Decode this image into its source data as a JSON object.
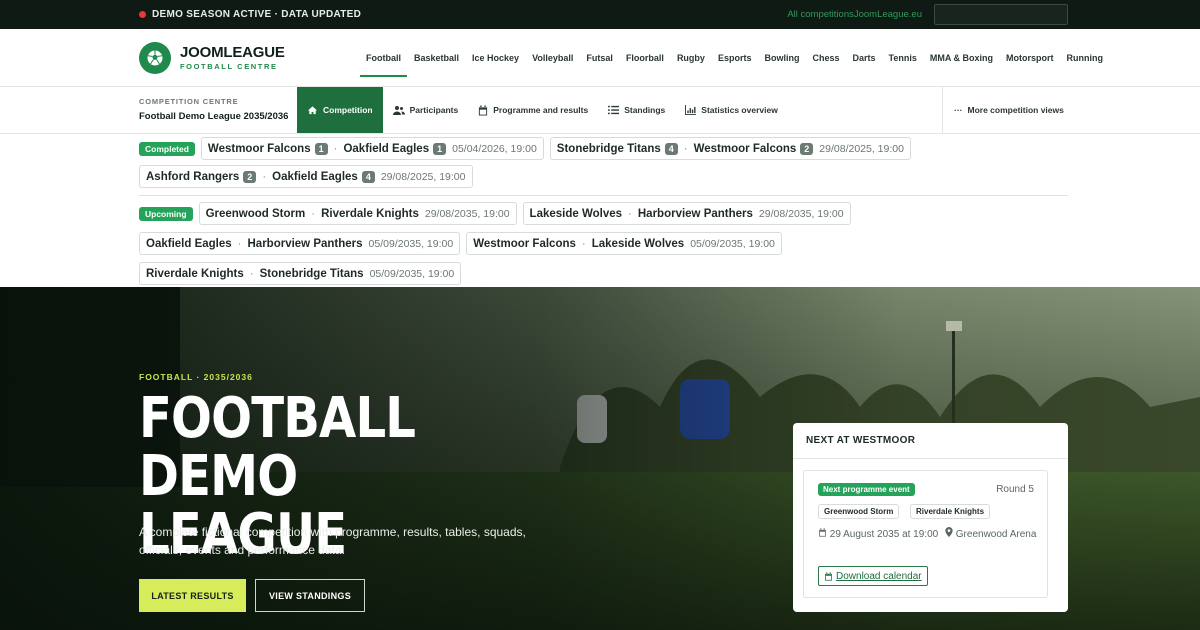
{
  "topbar": {
    "status": "DEMO SEASON ACTIVE · DATA UPDATED",
    "link": "All competitionsJoomLeague.eu",
    "search_value": ""
  },
  "brand": {
    "name": "JOOMLEAGUE",
    "tagline": "FOOTBALL CENTRE"
  },
  "nav": [
    "Football",
    "Basketball",
    "Ice Hockey",
    "Volleyball",
    "Futsal",
    "Floorball",
    "Rugby",
    "Esports",
    "Bowling",
    "Chess",
    "Darts",
    "Tennis",
    "MMA & Boxing",
    "Motorsport",
    "Running"
  ],
  "competition": {
    "label": "COMPETITION CENTRE",
    "name": "Football Demo League 2035/2036",
    "tabs": [
      "Competition",
      "Participants",
      "Programme and results",
      "Standings",
      "Statistics overview"
    ],
    "more": "More competition views"
  },
  "completed": {
    "badge": "Completed",
    "matches": [
      {
        "home": "Westmoor Falcons",
        "home_score": "1",
        "away": "Oakfield Eagles",
        "away_score": "1",
        "date": "05/04/2026, 19:00"
      },
      {
        "home": "Stonebridge Titans",
        "home_score": "4",
        "away": "Westmoor Falcons",
        "away_score": "2",
        "date": "29/08/2025, 19:00"
      },
      {
        "home": "Ashford Rangers",
        "home_score": "2",
        "away": "Oakfield Eagles",
        "away_score": "4",
        "date": "29/08/2025, 19:00"
      }
    ]
  },
  "upcoming": {
    "badge": "Upcoming",
    "matches": [
      {
        "home": "Greenwood Storm",
        "away": "Riverdale Knights",
        "date": "29/08/2035, 19:00"
      },
      {
        "home": "Lakeside Wolves",
        "away": "Harborview Panthers",
        "date": "29/08/2035, 19:00"
      },
      {
        "home": "Oakfield Eagles",
        "away": "Harborview Panthers",
        "date": "05/09/2035, 19:00"
      },
      {
        "home": "Westmoor Falcons",
        "away": "Lakeside Wolves",
        "date": "05/09/2035, 19:00"
      },
      {
        "home": "Riverdale Knights",
        "away": "Stonebridge Titans",
        "date": "05/09/2035, 19:00"
      }
    ]
  },
  "hero": {
    "eyebrow": "FOOTBALL · 2035/2036",
    "title_line1": "FOOTBALL DEMO",
    "title_line2": "LEAGUE",
    "description": "A complete fictional competition with programme, results, tables, squads, officials, events and performance data.",
    "btn_results": "LATEST RESULTS",
    "btn_standings": "VIEW STANDINGS"
  },
  "next": {
    "title": "NEXT AT WESTMOOR",
    "badge": "Next programme event",
    "round": "Round 5",
    "home": "Greenwood Storm",
    "away": "Riverdale Knights",
    "datetime": "29 August 2035 at 19:00",
    "venue": "Greenwood Arena",
    "download": "Download calendar"
  },
  "colors": {
    "brand_green": "#1f8a4c",
    "accent_lime": "#d6ec5a",
    "status_green": "#25a35a"
  },
  "icons": [
    "home-icon",
    "users-icon",
    "calendar-icon",
    "list-icon",
    "chart-icon",
    "ellipsis-icon",
    "map-pin-icon",
    "football-icon"
  ]
}
